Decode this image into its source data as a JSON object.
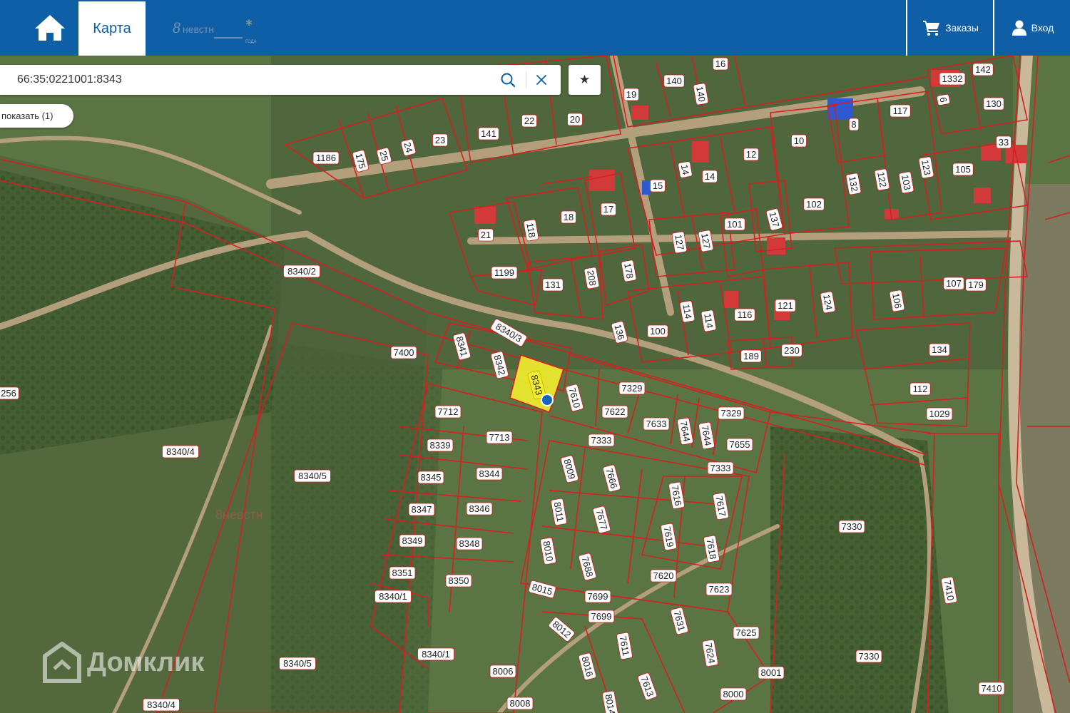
{
  "header": {
    "home_icon": "home-icon",
    "tab_label": "Карта",
    "orders_label": "Заказы",
    "orders_icon": "cart-icon",
    "login_label": "Вход",
    "login_icon": "user-icon"
  },
  "search": {
    "value": "66:35:0221001:8343",
    "search_icon": "search-icon",
    "clear_icon": "close-icon"
  },
  "favorite_icon": "star-icon",
  "show_button": {
    "label": "показать (1)"
  },
  "selected_parcel": {
    "label": "8343",
    "highlight_color": "#f2ee2e"
  },
  "parcels": [
    {
      "t": "140"
    },
    {
      "t": "16"
    },
    {
      "t": "19"
    },
    {
      "t": "140"
    },
    {
      "t": "1332"
    },
    {
      "t": "142"
    },
    {
      "t": "6"
    },
    {
      "t": "130"
    },
    {
      "t": "117"
    },
    {
      "t": "141"
    },
    {
      "t": "22"
    },
    {
      "t": "20"
    },
    {
      "t": "1186"
    },
    {
      "t": "175"
    },
    {
      "t": "25"
    },
    {
      "t": "24"
    },
    {
      "t": "23"
    },
    {
      "t": "10"
    },
    {
      "t": "8"
    },
    {
      "t": "33"
    },
    {
      "t": "14"
    },
    {
      "t": "14"
    },
    {
      "t": "12"
    },
    {
      "t": "15"
    },
    {
      "t": "105"
    },
    {
      "t": "123"
    },
    {
      "t": "103"
    },
    {
      "t": "122"
    },
    {
      "t": "132"
    },
    {
      "t": "102"
    },
    {
      "t": "21"
    },
    {
      "t": "118"
    },
    {
      "t": "18"
    },
    {
      "t": "17"
    },
    {
      "t": "137"
    },
    {
      "t": "101"
    },
    {
      "t": "127"
    },
    {
      "t": "127"
    },
    {
      "t": "1199"
    },
    {
      "t": "131"
    },
    {
      "t": "208"
    },
    {
      "t": "178"
    },
    {
      "t": "8340/2"
    },
    {
      "t": "107"
    },
    {
      "t": "179"
    },
    {
      "t": "106"
    },
    {
      "t": "124"
    },
    {
      "t": "121"
    },
    {
      "t": "116"
    },
    {
      "t": "114"
    },
    {
      "t": "114"
    },
    {
      "t": "100"
    },
    {
      "t": "136"
    },
    {
      "t": "7400"
    },
    {
      "t": "8341"
    },
    {
      "t": "8340/3"
    },
    {
      "t": "8342"
    },
    {
      "t": "189"
    },
    {
      "t": "230"
    },
    {
      "t": "134"
    },
    {
      "t": "7610"
    },
    {
      "t": "7329"
    },
    {
      "t": "112"
    },
    {
      "t": "1029"
    },
    {
      "t": "7712"
    },
    {
      "t": "7622"
    },
    {
      "t": "7633"
    },
    {
      "t": "7644"
    },
    {
      "t": "7644"
    },
    {
      "t": "7329"
    },
    {
      "t": "256"
    },
    {
      "t": "8340/4"
    },
    {
      "t": "8339"
    },
    {
      "t": "7713"
    },
    {
      "t": "7333"
    },
    {
      "t": "7655"
    },
    {
      "t": "8340/5"
    },
    {
      "t": "8345"
    },
    {
      "t": "8344"
    },
    {
      "t": "8009"
    },
    {
      "t": "7666"
    },
    {
      "t": "7333"
    },
    {
      "t": "8347"
    },
    {
      "t": "8346"
    },
    {
      "t": "8011"
    },
    {
      "t": "7677"
    },
    {
      "t": "7616"
    },
    {
      "t": "7617"
    },
    {
      "t": "7330"
    },
    {
      "t": "8349"
    },
    {
      "t": "8348"
    },
    {
      "t": "8010"
    },
    {
      "t": "7619"
    },
    {
      "t": "7618"
    },
    {
      "t": "8351"
    },
    {
      "t": "8350"
    },
    {
      "t": "7688"
    },
    {
      "t": "7620"
    },
    {
      "t": "8340/1"
    },
    {
      "t": "8015"
    },
    {
      "t": "7699"
    },
    {
      "t": "7623"
    },
    {
      "t": "7410"
    },
    {
      "t": "7699"
    },
    {
      "t": "8012"
    },
    {
      "t": "7631"
    },
    {
      "t": "7625"
    },
    {
      "t": "8340/1"
    },
    {
      "t": "8016"
    },
    {
      "t": "7611"
    },
    {
      "t": "7624"
    },
    {
      "t": "7330"
    },
    {
      "t": "8340/5"
    },
    {
      "t": "8006"
    },
    {
      "t": "8001"
    },
    {
      "t": "7613"
    },
    {
      "t": "8000"
    },
    {
      "t": "7410"
    },
    {
      "t": "8340/4"
    },
    {
      "t": "8008"
    },
    {
      "t": "8014"
    }
  ],
  "watermark": {
    "text": "Домклик",
    "icon": "domclick-logo-icon"
  },
  "colors": {
    "header_blue": "#0f5fa6",
    "parcel_border": "#d42020"
  }
}
